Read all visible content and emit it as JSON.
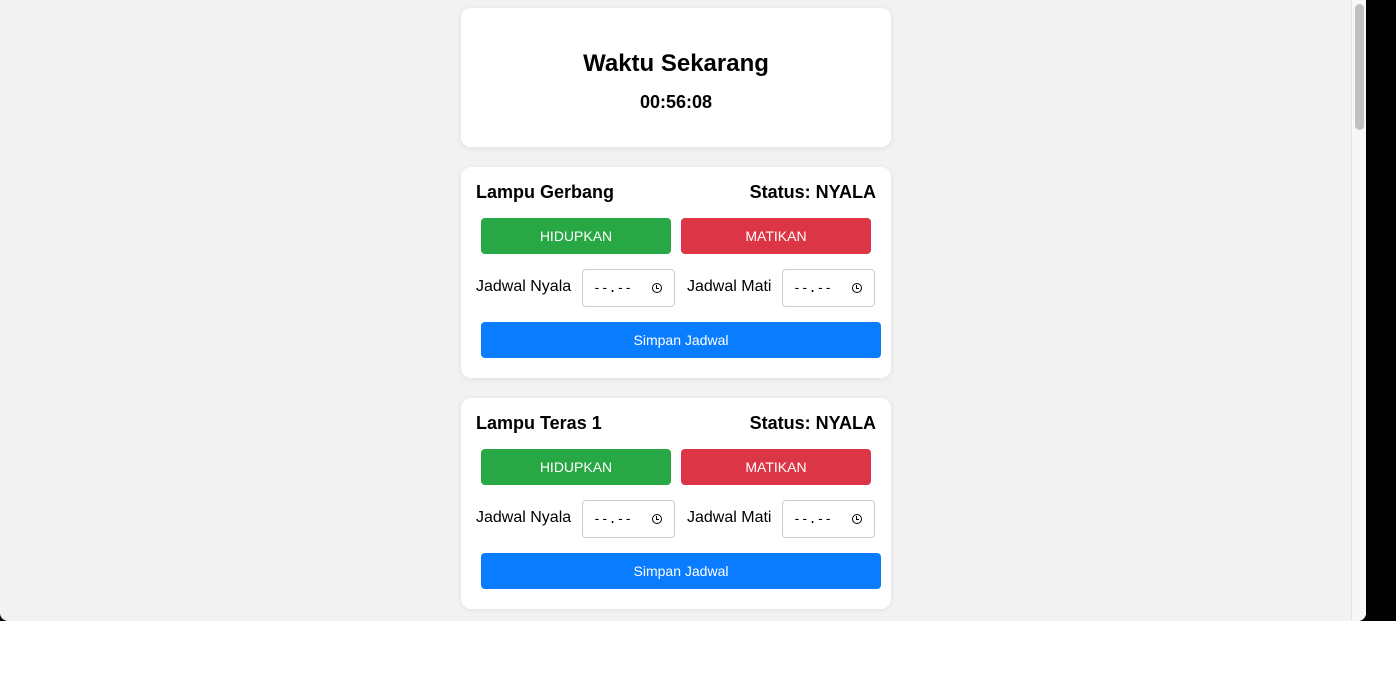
{
  "clock": {
    "title": "Waktu Sekarang",
    "time": "00:56:08"
  },
  "lamps": [
    {
      "name": "Lampu Gerbang",
      "status": "Status: NYALA",
      "on_label": "HIDUPKAN",
      "off_label": "MATIKAN",
      "schedule_on_label": "Jadwal Nyala",
      "schedule_off_label": "Jadwal Mati",
      "schedule_on_value": "--.--",
      "schedule_off_value": "--.--",
      "save_label": "Simpan Jadwal"
    },
    {
      "name": "Lampu Teras 1",
      "status": "Status: NYALA",
      "on_label": "HIDUPKAN",
      "off_label": "MATIKAN",
      "schedule_on_label": "Jadwal Nyala",
      "schedule_off_label": "Jadwal Mati",
      "schedule_on_value": "--.--",
      "schedule_off_value": "--.--",
      "save_label": "Simpan Jadwal"
    }
  ],
  "colors": {
    "on_button": "#28a745",
    "off_button": "#dc3545",
    "save_button": "#0a7cff",
    "page_background": "#f2f2f2"
  }
}
